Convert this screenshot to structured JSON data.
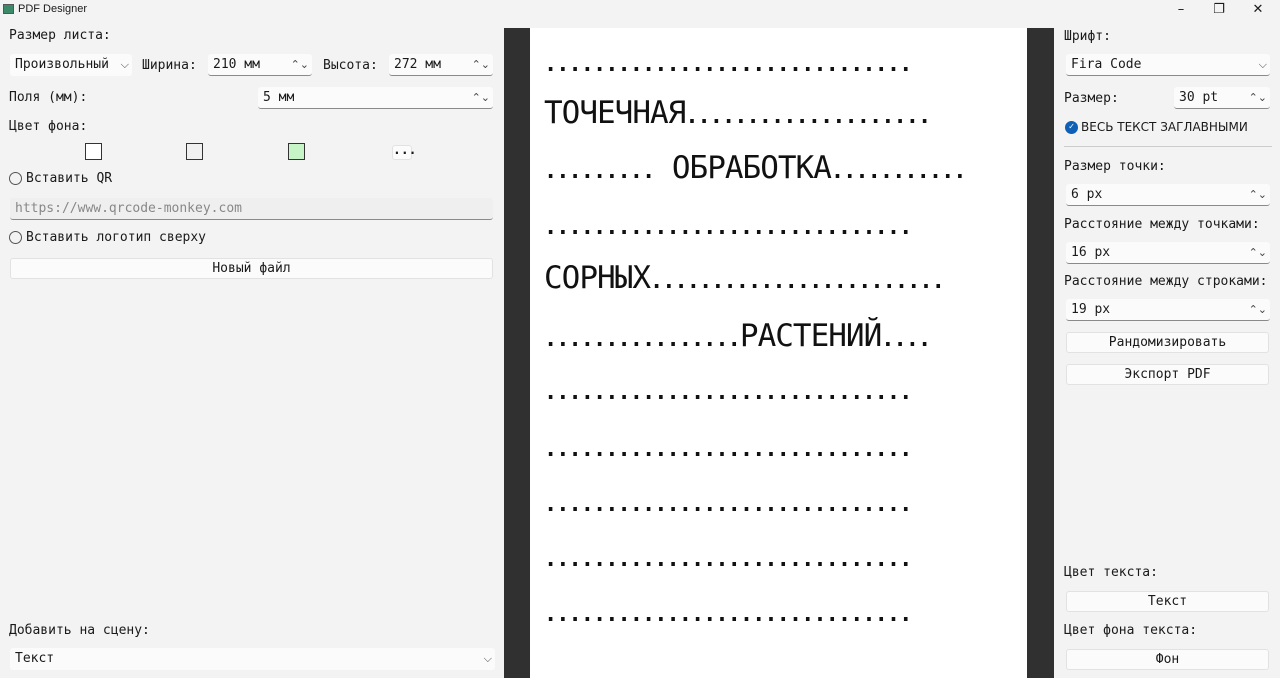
{
  "window": {
    "title": "PDF Designer",
    "minimize": "–",
    "restore": "❐",
    "close": "✕"
  },
  "left": {
    "sheet_size_label": "Размер листа:",
    "sheet_preset": "Произвольный",
    "width_label": "Ширина:",
    "width_value": "210 мм",
    "height_label": "Высота:",
    "height_value": "272 мм",
    "margins_label": "Поля (мм):",
    "margins_value": "5 мм",
    "bg_color_label": "Цвет фона:",
    "bg_swatches": [
      "#ffffff",
      "#f0f0f0",
      "#c8f5c8"
    ],
    "more_colors": "...",
    "insert_qr_label": "Вставить QR",
    "qr_placeholder": "https://www.qrcode-monkey.com",
    "insert_logo_label": "Вставить логотип сверху",
    "new_file": "Новый файл",
    "add_to_scene_label": "Добавить на сцену:",
    "add_to_scene_value": "Текст"
  },
  "preview": {
    "rows": [
      "••••••••••••••••••••••••••••••",
      "ТОЧЕЧНАЯ|••••••••••••••••••••",
      "•••••••••| ОБРАБОТКА|•••••••••••",
      "••••••••••••••••••••••••••••••",
      "СОРНЫХ|••••••••••••••••••••••••",
      "••••••••••••••••|РАСТЕНИЙ|••••",
      "••••••••••••••••••••••••••••••",
      "••••••••••••••••••••••••••••••",
      "••••••••••••••••••••••••••••••",
      "••••••••••••••••••••••••••••••",
      "••••••••••••••••••••••••••••••"
    ]
  },
  "right": {
    "font_label": "Шрифт:",
    "font_value": "Fira Code",
    "size_label": "Размер:",
    "size_value": "30 pt",
    "uppercase_label": "ВЕСЬ ТЕКСТ ЗАГЛАВНЫМИ",
    "uppercase_checked": true,
    "dot_size_label": "Размер точки:",
    "dot_size_value": "6 px",
    "dot_spacing_label": "Расстояние между точками:",
    "dot_spacing_value": "16 px",
    "line_spacing_label": "Расстояние между строками:",
    "line_spacing_value": "19 px",
    "randomize": "Рандомизировать",
    "export": "Экспорт PDF",
    "text_color_label": "Цвет текста:",
    "text_color_button": "Текст",
    "text_bg_label": "Цвет фона текста:",
    "text_bg_button": "Фон"
  },
  "colors": {
    "accent": "#0f5fb5",
    "canvas_bg": "#303030"
  }
}
